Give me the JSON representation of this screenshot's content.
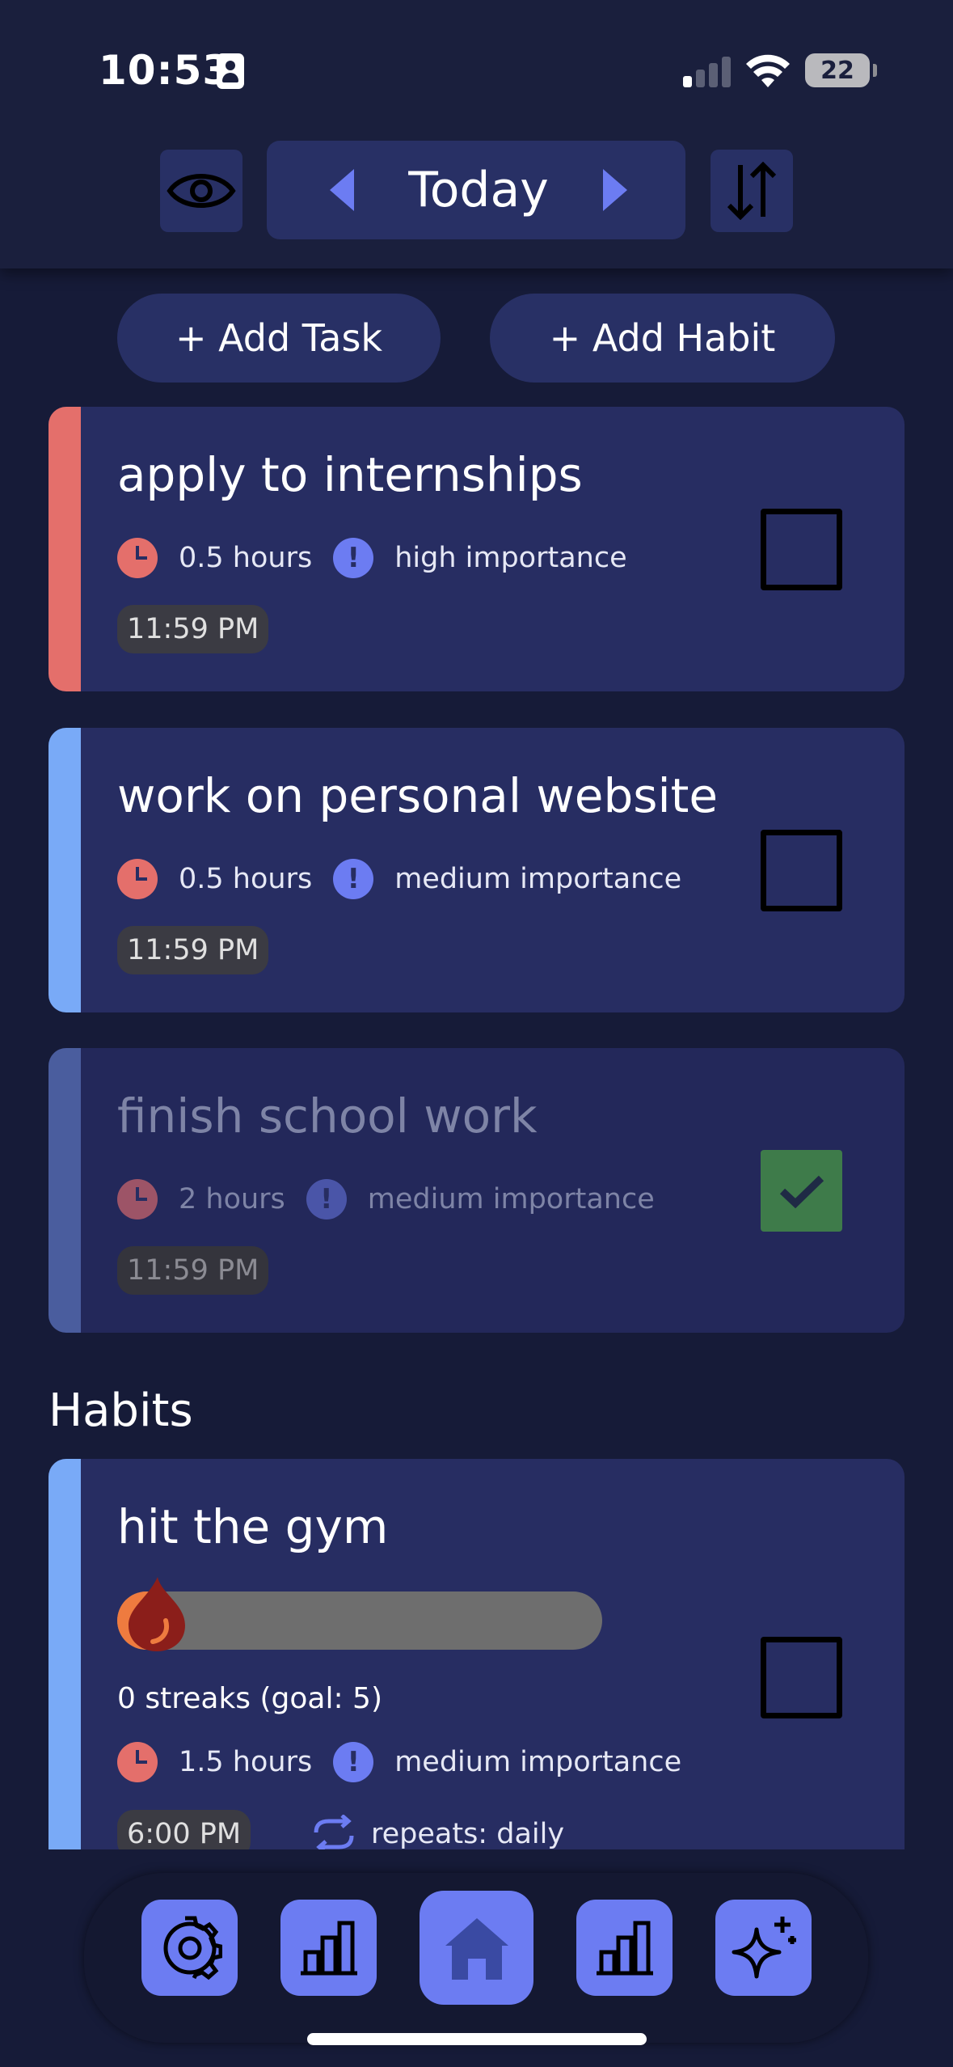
{
  "status_bar": {
    "time": "10:53",
    "battery": "22"
  },
  "header": {
    "date_label": "Today"
  },
  "actions": {
    "add_task": "+ Add Task",
    "add_habit": "+ Add Habit"
  },
  "colors": {
    "background": "#161b38",
    "card": "#272d62",
    "accent": "#6c7cf2",
    "high_priority": "#e46f6b",
    "medium_priority": "#79aaf7",
    "completed_green": "#3e7b4a"
  },
  "tasks": [
    {
      "title": "apply to internships",
      "duration": "0.5 hours",
      "importance": "high importance",
      "due": "11:59 PM",
      "completed": false,
      "stripe_color": "#e46f6b"
    },
    {
      "title": "work on personal website",
      "duration": "0.5 hours",
      "importance": "medium importance",
      "due": "11:59 PM",
      "completed": false,
      "stripe_color": "#79aaf7"
    },
    {
      "title": "finish school work",
      "duration": "2 hours",
      "importance": "medium importance",
      "due": "11:59 PM",
      "completed": true,
      "stripe_color": "#4a5d9e"
    }
  ],
  "habits_section": {
    "title": "Habits"
  },
  "habits": [
    {
      "title": "hit the gym",
      "streak_text": "0 streaks (goal: 5)",
      "streak_progress": 0.0,
      "duration": "1.5 hours",
      "importance": "medium importance",
      "time": "6:00 PM",
      "repeat": "repeats: daily",
      "completed": false,
      "stripe_color": "#79aaf7"
    }
  ],
  "tabbar": {
    "items": [
      {
        "icon": "gear-icon"
      },
      {
        "icon": "bar-chart-icon"
      },
      {
        "icon": "home-icon",
        "active": true
      },
      {
        "icon": "bar-chart-icon"
      },
      {
        "icon": "sparkle-icon"
      }
    ]
  }
}
